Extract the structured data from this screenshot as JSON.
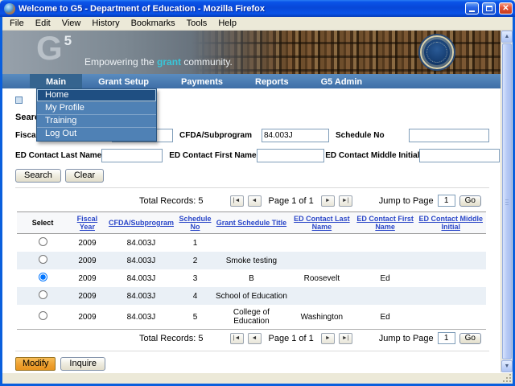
{
  "window": {
    "title": "Welcome to G5 - Department of Education - Mozilla Firefox",
    "menu_items": [
      "File",
      "Edit",
      "View",
      "History",
      "Bookmarks",
      "Tools",
      "Help"
    ]
  },
  "banner": {
    "logo_g": "G",
    "logo_5": "5",
    "tagline_pre": "Empowering the ",
    "tagline_highlight": "grant",
    "tagline_post": " community."
  },
  "nav": {
    "items": [
      "Main",
      "Grant Setup",
      "Payments",
      "Reports",
      "G5 Admin"
    ]
  },
  "menu_dropdown": {
    "items": [
      "Home",
      "My Profile",
      "Training",
      "Log Out"
    ]
  },
  "search": {
    "heading": "Search",
    "fiscal_year_label": "Fiscal Year",
    "cfda_label": "CFDA/Subprogram",
    "cfda_value": "84.003J",
    "schedule_no_label": "Schedule No",
    "last_name_label": "ED Contact Last Name",
    "first_name_label": "ED Contact First Name",
    "middle_initial_label": "ED Contact Middle Initial",
    "search_button": "Search",
    "clear_button": "Clear"
  },
  "pagination": {
    "total_label": "Total Records:",
    "total_value": "5",
    "page_text": "Page 1 of 1",
    "jump_label": "Jump to Page",
    "jump_value": "1",
    "go_button": "Go",
    "first_glyph": "|◄",
    "prev_glyph": "◄",
    "next_glyph": "►",
    "last_glyph": "►|"
  },
  "table": {
    "headers": [
      "Select",
      "Fiscal Year",
      "CFDA/Subprogram",
      "Schedule No",
      "Grant Schedule Title",
      "ED Contact Last Name",
      "ED Contact First Name",
      "ED Contact Middle Initial"
    ],
    "selected_index": 2,
    "rows": [
      {
        "fy": "2009",
        "cfda": "84.003J",
        "sched": "1",
        "title": "",
        "last": "",
        "first": "",
        "middle": ""
      },
      {
        "fy": "2009",
        "cfda": "84.003J",
        "sched": "2",
        "title": "Smoke testing",
        "last": "",
        "first": "",
        "middle": ""
      },
      {
        "fy": "2009",
        "cfda": "84.003J",
        "sched": "3",
        "title": "B",
        "last": "Roosevelt",
        "first": "Ed",
        "middle": ""
      },
      {
        "fy": "2009",
        "cfda": "84.003J",
        "sched": "4",
        "title": "School of Education",
        "last": "",
        "first": "",
        "middle": ""
      },
      {
        "fy": "2009",
        "cfda": "84.003J",
        "sched": "5",
        "title": "College of Education",
        "last": "Washington",
        "first": "Ed",
        "middle": ""
      }
    ]
  },
  "actions": {
    "modify": "Modify",
    "inquire": "Inquire"
  },
  "colors": {
    "nav_blue": "#3e6ea6",
    "accent_teal": "#38c7da",
    "modify_orange": "#ee9f2e",
    "titlebar_blue": "#0a53e8"
  }
}
